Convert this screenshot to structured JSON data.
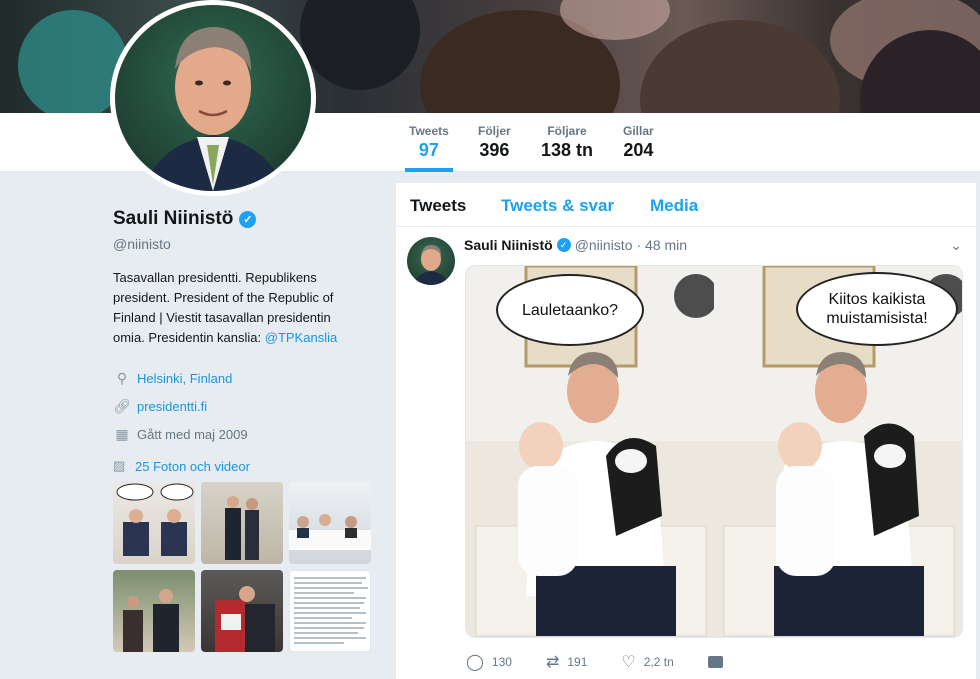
{
  "stats": [
    {
      "label": "Tweets",
      "value": "97"
    },
    {
      "label": "Följer",
      "value": "396"
    },
    {
      "label": "Följare",
      "value": "138 tn"
    },
    {
      "label": "Gillar",
      "value": "204"
    }
  ],
  "profile": {
    "name": "Sauli Niinistö",
    "handle": "@niinisto",
    "bio_text": "Tasavallan presidentti. Republikens president. President of the Republic of Finland | Viestit tasavallan presidentin omia. Presidentin kanslia: ",
    "bio_link": "@TPKanslia",
    "location": "Helsinki, Finland",
    "website": "presidentti.fi",
    "joined": "Gått med maj 2009",
    "media_link": "25 Foton och videor"
  },
  "tabs": [
    "Tweets",
    "Tweets & svar",
    "Media"
  ],
  "tweet": {
    "name": "Sauli Niinistö",
    "handle": "@niinisto",
    "time": "· 48 min",
    "bubble_left": "Lauletaanko?",
    "bubble_right_1": "Kiitos kaikista",
    "bubble_right_2": "muistamisista!",
    "replies": "130",
    "retweets": "191",
    "likes": "2,2 tn"
  },
  "icons": {
    "verified": "verified-badge-icon",
    "location": "map-pin-icon",
    "link": "link-icon",
    "calendar": "calendar-icon",
    "media": "image-icon",
    "reply": "reply-icon",
    "retweet": "retweet-icon",
    "like": "heart-icon",
    "dm": "direct-message-icon",
    "caret": "chevron-down-icon"
  },
  "colors": {
    "accent": "#1da1f2",
    "background": "#e6ecf0"
  }
}
